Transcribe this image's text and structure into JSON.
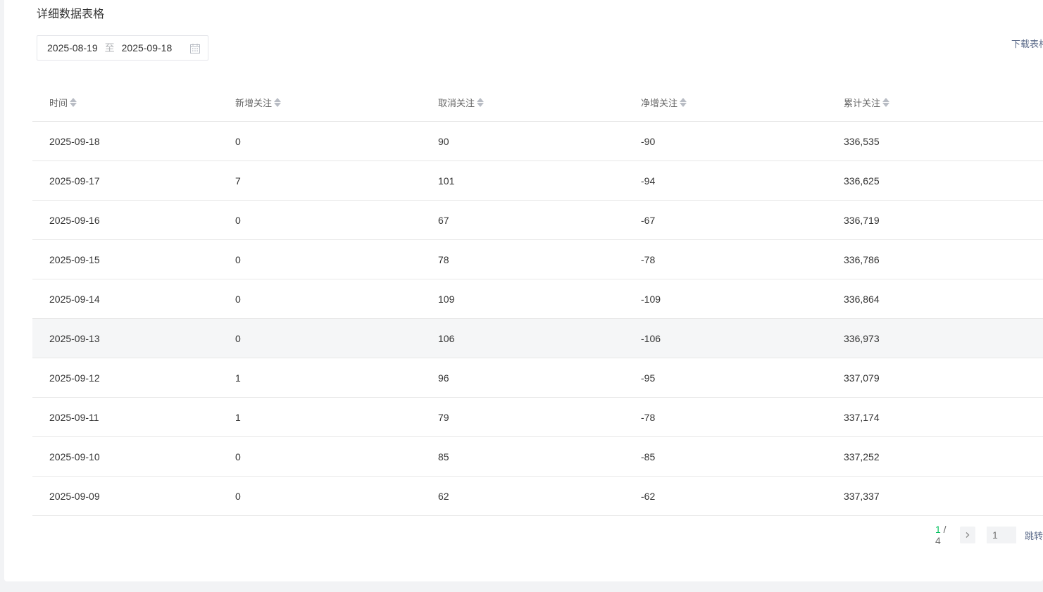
{
  "card": {
    "title": "详细数据表格"
  },
  "filter": {
    "date_start": "2025-08-19",
    "date_sep": "至",
    "date_end": "2025-09-18",
    "download_label": "下载表格"
  },
  "table": {
    "columns": [
      "时间",
      "新增关注",
      "取消关注",
      "净增关注",
      "累计关注"
    ],
    "rows": [
      [
        "2025-09-18",
        "0",
        "90",
        "-90",
        "336,535"
      ],
      [
        "2025-09-17",
        "7",
        "101",
        "-94",
        "336,625"
      ],
      [
        "2025-09-16",
        "0",
        "67",
        "-67",
        "336,719"
      ],
      [
        "2025-09-15",
        "0",
        "78",
        "-78",
        "336,786"
      ],
      [
        "2025-09-14",
        "0",
        "109",
        "-109",
        "336,864"
      ],
      [
        "2025-09-13",
        "0",
        "106",
        "-106",
        "336,973"
      ],
      [
        "2025-09-12",
        "1",
        "96",
        "-95",
        "337,079"
      ],
      [
        "2025-09-11",
        "1",
        "79",
        "-78",
        "337,174"
      ],
      [
        "2025-09-10",
        "0",
        "85",
        "-85",
        "337,252"
      ],
      [
        "2025-09-09",
        "0",
        "62",
        "-62",
        "337,337"
      ]
    ]
  },
  "pagination": {
    "current": "1",
    "separator": " / ",
    "total": "4",
    "input_placeholder": "1",
    "jump_label": "跳转"
  }
}
